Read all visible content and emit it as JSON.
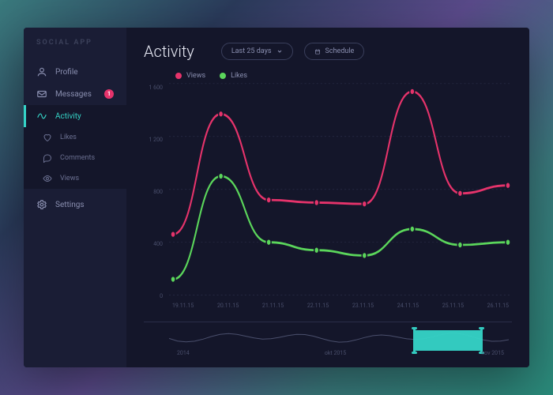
{
  "brand": "SOCIAL APP",
  "sidebar": {
    "items": [
      {
        "key": "profile",
        "label": "Profile",
        "icon": "user-icon"
      },
      {
        "key": "messages",
        "label": "Messages",
        "icon": "mail-icon",
        "badge": "1"
      },
      {
        "key": "activity",
        "label": "Activity",
        "icon": "activity-icon",
        "active": true
      },
      {
        "key": "likes",
        "label": "Likes",
        "icon": "heart-icon",
        "sub": true
      },
      {
        "key": "comments",
        "label": "Comments",
        "icon": "comment-icon",
        "sub": true
      },
      {
        "key": "views",
        "label": "Views",
        "icon": "eye-icon",
        "sub": true
      },
      {
        "key": "settings",
        "label": "Settings",
        "icon": "gear-icon"
      }
    ]
  },
  "header": {
    "title": "Activity",
    "range_label": "Last 25 days",
    "schedule_label": "Schedule"
  },
  "legend": {
    "series": [
      {
        "name": "Views",
        "color": "#e6336b"
      },
      {
        "name": "Likes",
        "color": "#5bd65b"
      }
    ]
  },
  "colors": {
    "accent": "#35d4c7",
    "bg_app": "#1a1d35",
    "bg_main": "#14162a",
    "pink": "#e6336b",
    "green": "#5bd65b",
    "text_dim": "#4a4f6c",
    "text": "#8a8fb0"
  },
  "scrubber": {
    "labels": [
      "2014",
      "okt 2015",
      "nov 2015"
    ],
    "window_start_pct": 72,
    "window_width_pct": 20
  },
  "chart_data": {
    "type": "line",
    "title": "Activity",
    "xlabel": "",
    "ylabel": "",
    "ylim": [
      0,
      1600
    ],
    "yticks": [
      1600,
      1200,
      800,
      400,
      0
    ],
    "categories": [
      "19.11.15",
      "20.11.15",
      "21.11.15",
      "22.11.15",
      "23.11.15",
      "24.11.15",
      "25.11.15",
      "26.11.15"
    ],
    "series": [
      {
        "name": "Views",
        "color": "#e6336b",
        "values": [
          460,
          1370,
          720,
          700,
          690,
          1540,
          770,
          830
        ]
      },
      {
        "name": "Likes",
        "color": "#5bd65b",
        "values": [
          120,
          900,
          400,
          340,
          300,
          500,
          380,
          400
        ]
      }
    ]
  }
}
